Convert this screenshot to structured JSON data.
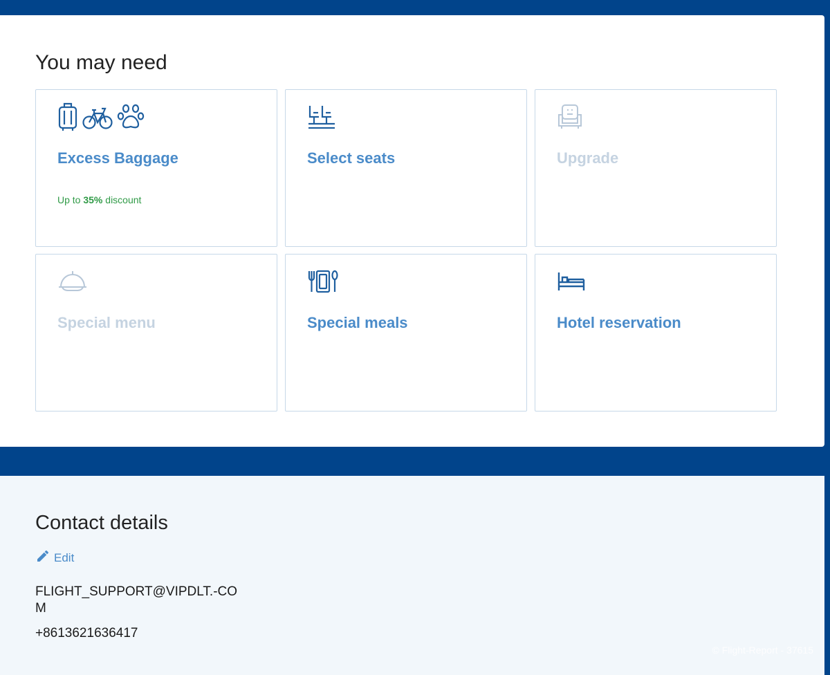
{
  "need": {
    "title": "You may need",
    "tiles": [
      {
        "label": "Excess Baggage",
        "promo_prefix": "Up to ",
        "promo_value": "35%",
        "promo_suffix": " discount",
        "state": "enabled",
        "icons": [
          "suitcase-icon",
          "bicycle-icon",
          "paw-icon"
        ]
      },
      {
        "label": "Select seats",
        "state": "enabled",
        "icons": [
          "seats-icon"
        ]
      },
      {
        "label": "Upgrade",
        "state": "disabled",
        "icons": [
          "armchair-icon"
        ]
      },
      {
        "label": "Special menu",
        "state": "disabled",
        "icons": [
          "cloche-icon"
        ]
      },
      {
        "label": "Special meals",
        "state": "enabled",
        "icons": [
          "meal-icon"
        ]
      },
      {
        "label": "Hotel reservation",
        "state": "enabled",
        "icons": [
          "bed-icon"
        ]
      }
    ]
  },
  "contact": {
    "title": "Contact details",
    "edit_label": "Edit",
    "email": "FLIGHT_SUPPORT@VIPDLT.-COM",
    "phone": "+8613621636417"
  },
  "watermark": "© Flight-Report - 37615",
  "colors": {
    "background": "#01448b",
    "accent": "#4a8bc9",
    "icon_active": "#1f5f9f",
    "disabled": "#c5d3e1",
    "promo": "#2f9a46"
  }
}
